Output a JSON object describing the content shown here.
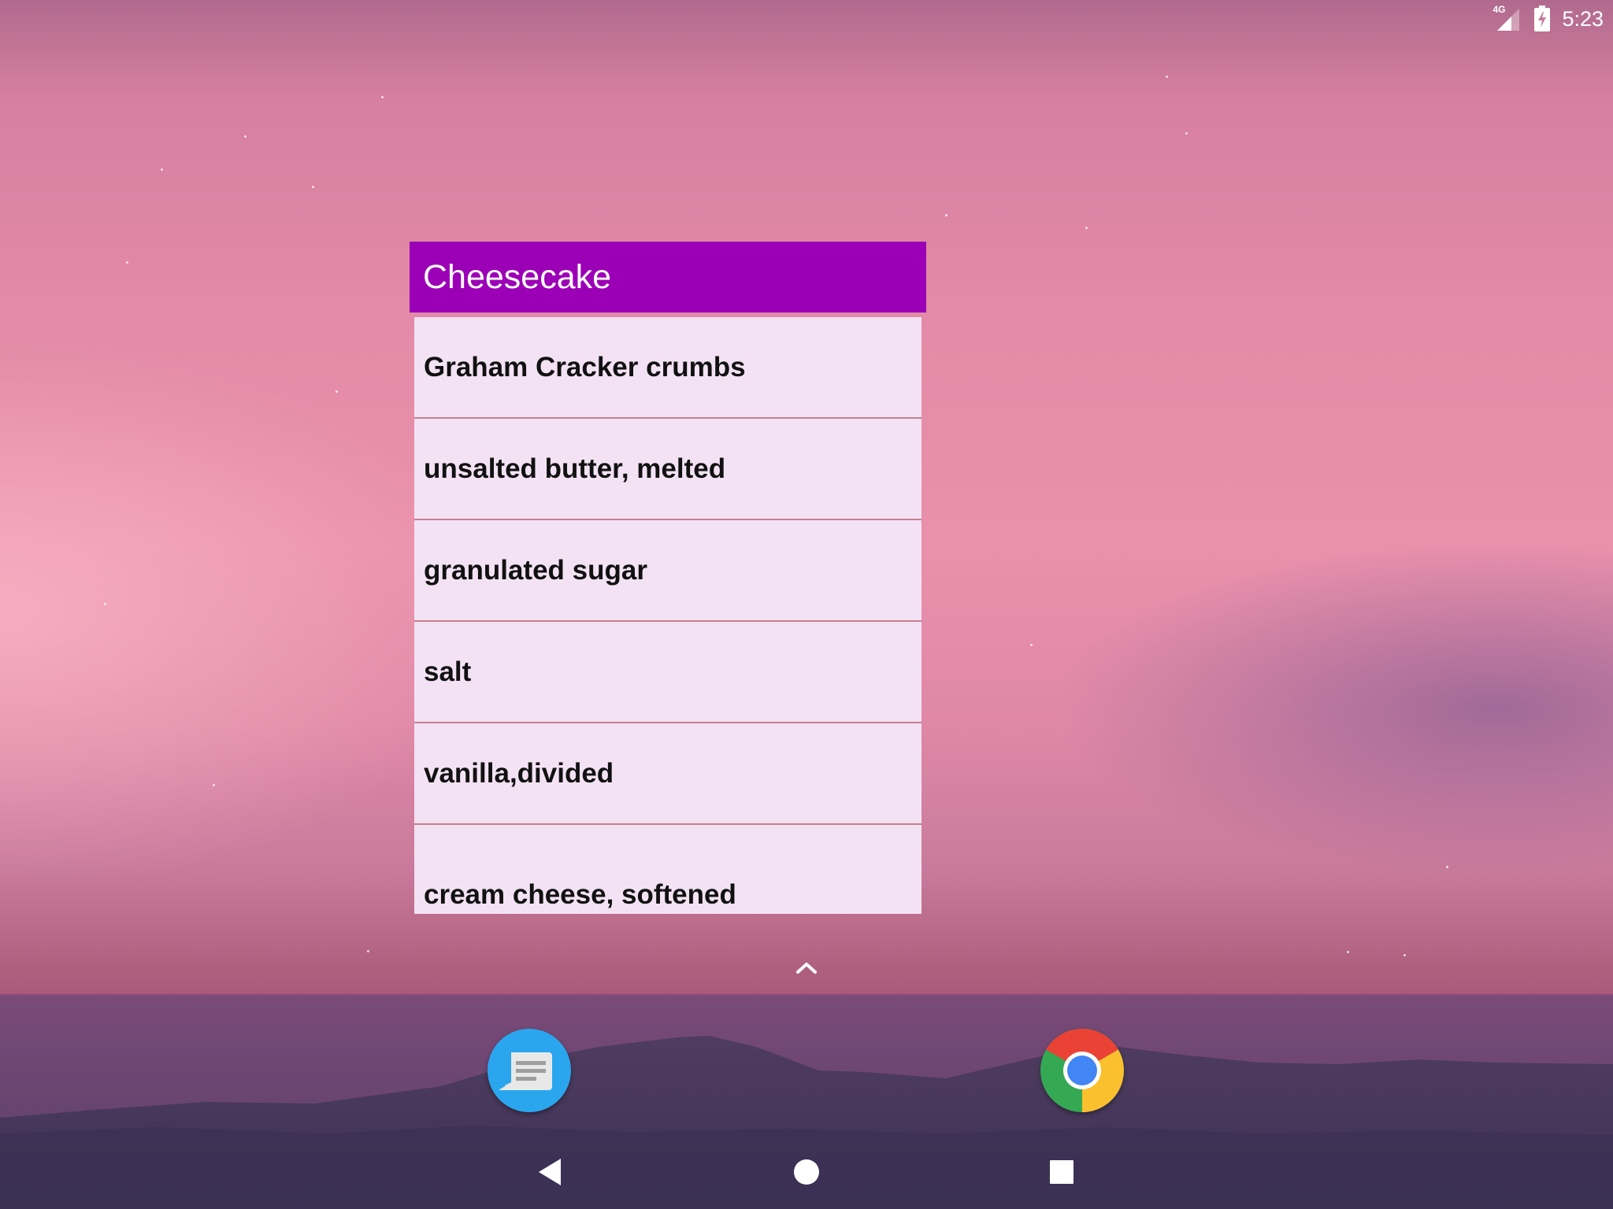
{
  "status_bar": {
    "network": "4G",
    "time": "5:23"
  },
  "widget": {
    "title": "Cheesecake",
    "ingredients": [
      "Graham Cracker crumbs",
      "unsalted butter, melted",
      "granulated sugar",
      "salt",
      "vanilla,divided",
      "cream cheese, softened"
    ]
  },
  "dock": {
    "apps": [
      "messages-icon",
      "chrome-icon"
    ],
    "all_apps": "chevron-up-icon"
  },
  "nav_bar": {
    "buttons": [
      "back-icon",
      "home-icon",
      "recents-icon"
    ]
  },
  "colors": {
    "header": "#9c00b6",
    "list_bg": "#f3e2f4",
    "divider": "#c87e90",
    "messages": "#2aa6ee"
  }
}
